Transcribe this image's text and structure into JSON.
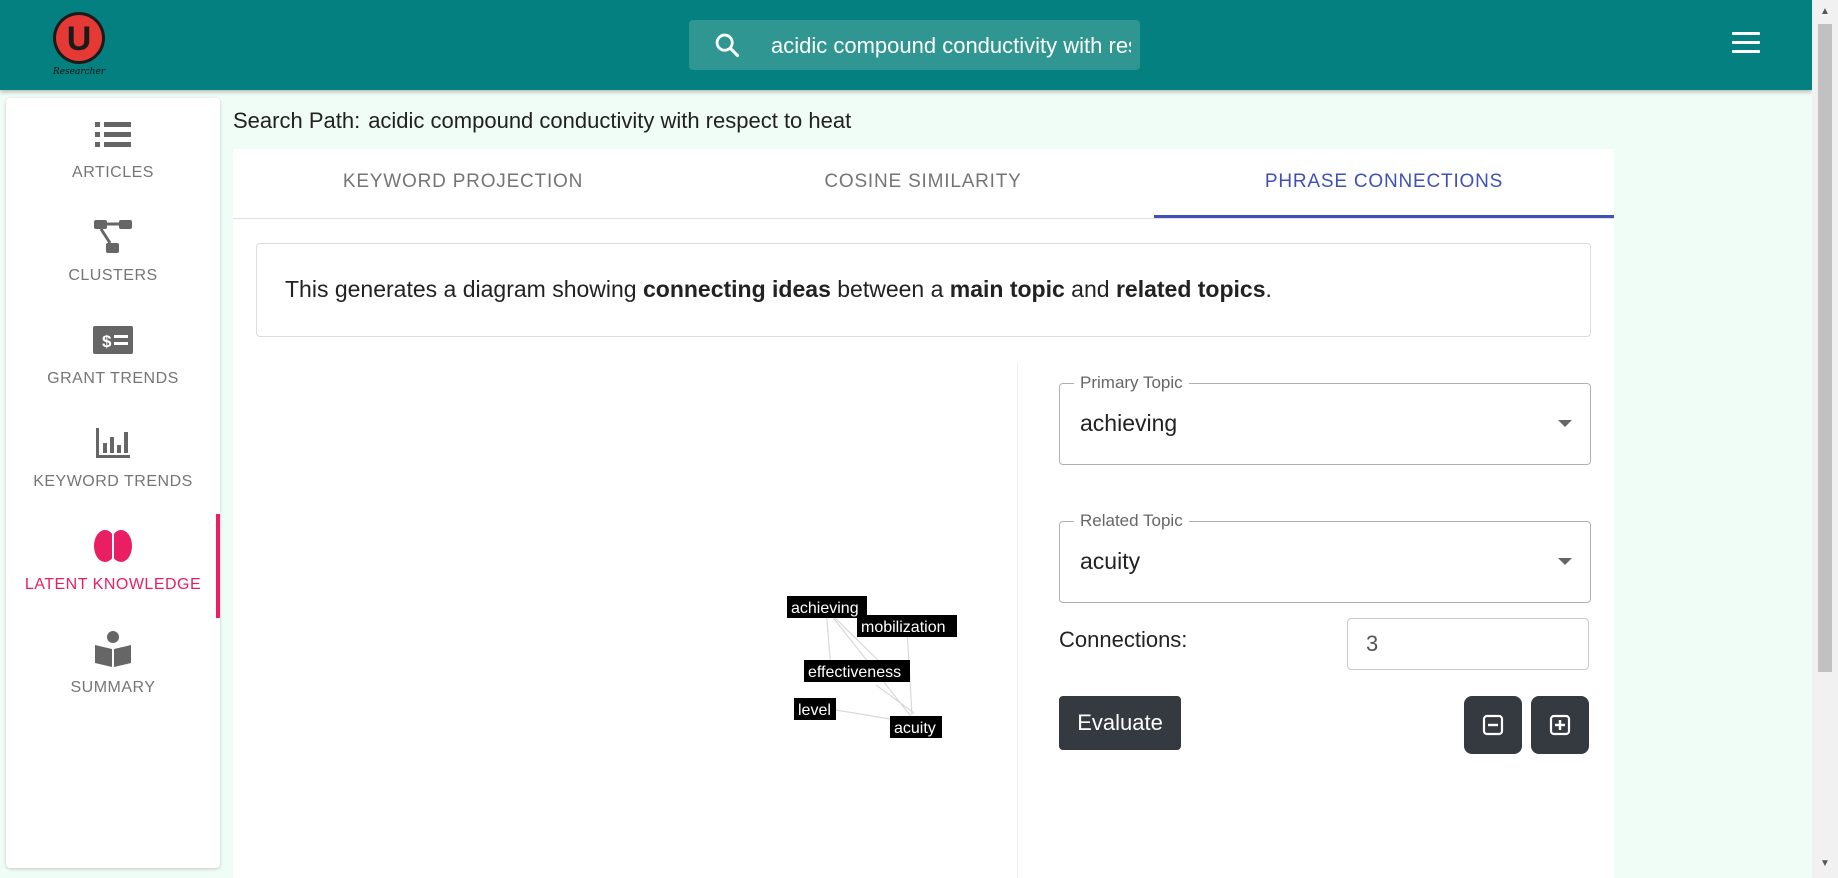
{
  "header": {
    "logo_letter": "U",
    "logo_caption": "Researcher",
    "search_value": "acidic compound conductivity with respect to heat",
    "search_icon": "search-icon",
    "menu_icon": "hamburger-menu-icon"
  },
  "sidebar": {
    "items": [
      {
        "label": "ARTICLES",
        "icon": "list-icon",
        "active": false
      },
      {
        "label": "CLUSTERS",
        "icon": "hierarchy-icon",
        "active": false
      },
      {
        "label": "GRANT TRENDS",
        "icon": "money-bill-icon",
        "active": false
      },
      {
        "label": "KEYWORD TRENDS",
        "icon": "bar-chart-icon",
        "active": false
      },
      {
        "label": "LATENT KNOWLEDGE",
        "icon": "brain-icon",
        "active": true
      },
      {
        "label": "SUMMARY",
        "icon": "reader-icon",
        "active": false
      }
    ]
  },
  "breadcrumb": {
    "label": "Search Path:",
    "value": "acidic compound conductivity with respect to heat"
  },
  "tabs": [
    {
      "label": "KEYWORD PROJECTION",
      "active": false
    },
    {
      "label": "COSINE SIMILARITY",
      "active": false
    },
    {
      "label": "PHRASE CONNECTIONS",
      "active": true
    }
  ],
  "info": {
    "part1": "This generates a diagram showing ",
    "bold1": "connecting ideas",
    "part2": " between a ",
    "bold2": "main topic",
    "part3": " and ",
    "bold3": "related topics",
    "part4": "."
  },
  "diagram": {
    "nodes": [
      "achieving",
      "mobilization",
      "effectiveness",
      "level",
      "acuity"
    ],
    "edges": [
      [
        "achieving",
        "effectiveness"
      ],
      [
        "achieving",
        "level"
      ],
      [
        "achieving",
        "acuity"
      ],
      [
        "mobilization",
        "acuity"
      ],
      [
        "effectiveness",
        "acuity"
      ],
      [
        "level",
        "acuity"
      ]
    ]
  },
  "form": {
    "primary_label": "Primary Topic",
    "primary_value": "achieving",
    "related_label": "Related Topic",
    "related_value": "acuity",
    "connections_label": "Connections:",
    "connections_value": "3",
    "evaluate_label": "Evaluate",
    "zoom_out_icon": "minus-square-icon",
    "zoom_in_icon": "plus-square-icon"
  },
  "colors": {
    "header": "#03807f",
    "active_nav": "#e91e63",
    "active_tab": "#3f51b5",
    "button_dark": "#343a40"
  }
}
